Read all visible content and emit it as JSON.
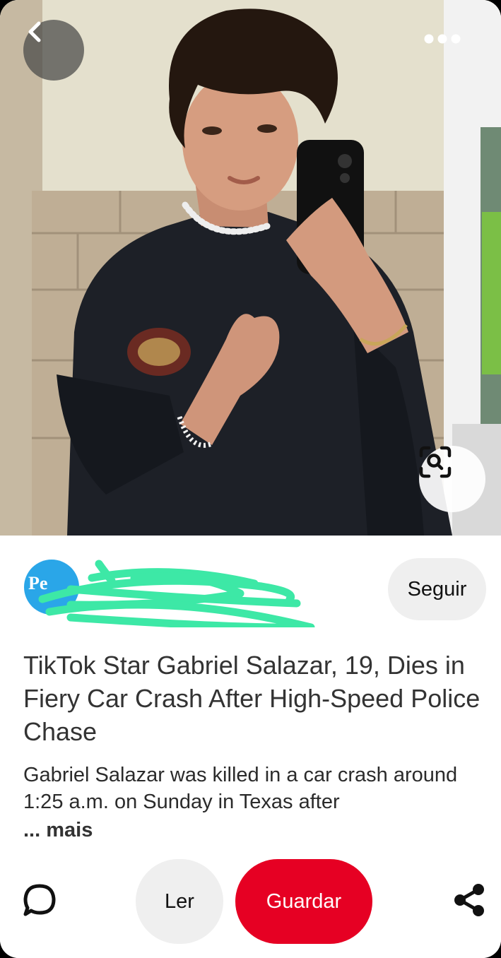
{
  "header": {
    "back_icon": "chevron-left-icon",
    "more_icon": "more-horizontal-icon",
    "visual_search_icon": "visual-search-icon"
  },
  "creator": {
    "avatar_text": "Pe",
    "follow_label": "Seguir"
  },
  "pin": {
    "title": "TikTok Star Gabriel Salazar, 19, Dies in Fiery Car Crash After High-Speed Police Chase",
    "description": "Gabriel Salazar was killed in a car crash around 1:25 a.m. on Sunday in Texas after",
    "more_label": "... mais"
  },
  "actions": {
    "comment_icon": "comment-icon",
    "read_label": "Ler",
    "save_label": "Guardar",
    "share_icon": "share-icon"
  },
  "colors": {
    "save": "#e60023",
    "follow_bg": "#efefef",
    "avatar": "#2aa6e8",
    "scribble": "#3de8a6"
  }
}
